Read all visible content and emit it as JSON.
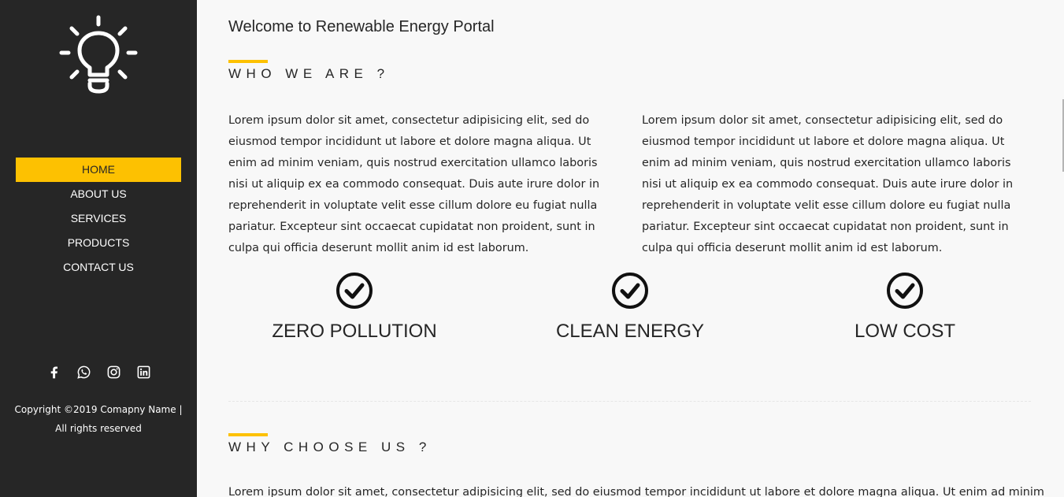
{
  "colors": {
    "sidebar_bg": "#262626",
    "accent": "#fdc101",
    "page_bg": "#f8f8f8"
  },
  "logo": {
    "icon": "lightbulb-icon"
  },
  "nav": {
    "items": [
      {
        "label": "HOME",
        "active": true
      },
      {
        "label": "ABOUT US",
        "active": false
      },
      {
        "label": "SERVICES",
        "active": false
      },
      {
        "label": "PRODUCTS",
        "active": false
      },
      {
        "label": "CONTACT US",
        "active": false
      }
    ]
  },
  "social": {
    "icons": [
      "facebook-icon",
      "whatsapp-icon",
      "instagram-icon",
      "linkedin-icon"
    ]
  },
  "footer": {
    "copyright_line1": "Copyright ©2019 Comapny Name |",
    "copyright_line2": "All rights reserved"
  },
  "main": {
    "welcome": "Welcome to Renewable Energy Portal",
    "who_heading": "WHO WE ARE ?",
    "who_paragraphs": [
      "Lorem ipsum dolor sit amet, consectetur adipisicing elit, sed do eiusmod tempor incididunt ut labore et dolore magna aliqua. Ut enim ad minim veniam, quis nostrud exercitation ullamco laboris nisi ut aliquip ex ea commodo consequat. Duis aute irure dolor in reprehenderit in voluptate velit esse cillum dolore eu fugiat nulla pariatur. Excepteur sint occaecat cupidatat non proident, sunt in culpa qui officia deserunt mollit anim id est laborum.",
      "Lorem ipsum dolor sit amet, consectetur adipisicing elit, sed do eiusmod tempor incididunt ut labore et dolore magna aliqua. Ut enim ad minim veniam, quis nostrud exercitation ullamco laboris nisi ut aliquip ex ea commodo consequat. Duis aute irure dolor in reprehenderit in voluptate velit esse cillum dolore eu fugiat nulla pariatur. Excepteur sint occaecat cupidatat non proident, sunt in culpa qui officia deserunt mollit anim id est laborum."
    ],
    "features": [
      {
        "icon": "check-circle-icon",
        "label": "ZERO POLLUTION"
      },
      {
        "icon": "check-circle-icon",
        "label": "CLEAN ENERGY"
      },
      {
        "icon": "check-circle-icon",
        "label": "LOW COST"
      }
    ],
    "why_heading": "WHY CHOOSE US ?",
    "why_paragraph": "Lorem ipsum dolor sit amet, consectetur adipisicing elit, sed do eiusmod tempor incididunt ut labore et dolore magna aliqua. Ut enim ad minim"
  }
}
